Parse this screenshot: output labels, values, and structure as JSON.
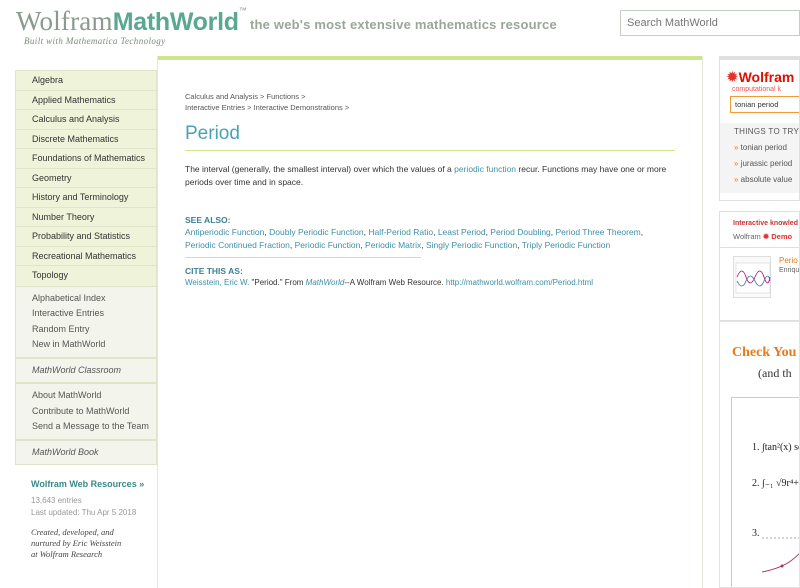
{
  "header": {
    "logo_wolfram": "Wolfram",
    "logo_mathworld": "MathWorld",
    "logo_tm": "™",
    "tagline": "the web's most extensive mathematics resource",
    "subtagline": "Built with Mathematica Technology",
    "search_placeholder": "Search MathWorld"
  },
  "sidebar": {
    "topics": [
      {
        "label": "Algebra"
      },
      {
        "label": "Applied Mathematics"
      },
      {
        "label": "Calculus and Analysis"
      },
      {
        "label": "Discrete Mathematics"
      },
      {
        "label": "Foundations of Mathematics"
      },
      {
        "label": "Geometry"
      },
      {
        "label": "History and Terminology"
      },
      {
        "label": "Number Theory"
      },
      {
        "label": "Probability and Statistics"
      },
      {
        "label": "Recreational Mathematics"
      },
      {
        "label": "Topology"
      }
    ],
    "links": [
      {
        "label": "Alphabetical Index"
      },
      {
        "label": "Interactive Entries"
      },
      {
        "label": "Random Entry"
      },
      {
        "label": "New in MathWorld"
      }
    ],
    "classroom": "MathWorld Classroom",
    "about_links": [
      {
        "label": "About MathWorld"
      },
      {
        "label": "Contribute to MathWorld"
      },
      {
        "label": "Send a Message to the Team"
      }
    ],
    "book": "MathWorld Book",
    "web_resources": "Wolfram Web Resources »",
    "entries": "13,643 entries",
    "updated": "Last updated: Thu Apr 5 2018",
    "credit_lines": [
      "Created, developed, and",
      "nurtured by Eric Weisstein",
      "at Wolfram Research"
    ]
  },
  "main": {
    "breadcrumb_line1": "Calculus and Analysis > Functions >",
    "breadcrumb_line2": "Interactive Entries > Interactive Demonstrations >",
    "title": "Period",
    "body_pre": "The interval (generally, the smallest interval) over which the values of a ",
    "body_link": "periodic function",
    "body_post": " recur. Functions may have one or more periods over time and in space.",
    "see_also_heading": "SEE ALSO:",
    "see_also": [
      "Antiperiodic Function",
      "Doubly Periodic Function",
      "Half-Period Ratio",
      "Least Period",
      "Period Doubling",
      "Period Three Theorem",
      "Periodic Continued Fraction",
      "Periodic Function",
      "Periodic Matrix",
      "Singly Periodic Function",
      "Triply Periodic Function"
    ],
    "cite_heading": "CITE THIS AS:",
    "cite_author": "Weisstein, Eric W.",
    "cite_title": " \"Period.\" From ",
    "cite_mw": "MathWorld",
    "cite_rest": "--A Wolfram Web Resource. ",
    "cite_url": "http://mathworld.wolfram.com/Period.html"
  },
  "right": {
    "wa_logo": "Wolfram",
    "wa_sub": "computational k",
    "wa_input": "tonian period",
    "things_heading": "THINGS TO TRY",
    "things": [
      "tonian period",
      "jurassic period",
      "absolute value"
    ],
    "demo_heading": "Interactive knowled",
    "demo_wolfram": "Wolfram",
    "demo_brand": "Demo",
    "demo_title": "Perio",
    "demo_author": "Enriqu",
    "ad_line1": "Check You",
    "ad_line2": "(and th",
    "ad_eq1": "1. ∫tan²(x) sec²",
    "ad_eq2": "2. ∫₋₁ √9r⁴+4r²",
    "ad_eq3": "3."
  }
}
